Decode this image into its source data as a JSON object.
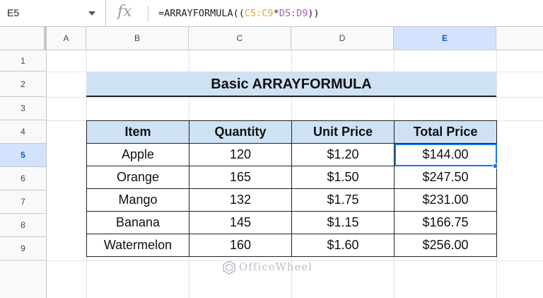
{
  "formula_bar": {
    "cell_ref": "E5",
    "fx_label": "fx",
    "formula_prefix": "=ARRAYFORMULA((",
    "range1": "C5:C9",
    "operator": "*",
    "range2": "D5:D9",
    "formula_suffix": "))"
  },
  "columns": [
    "A",
    "B",
    "C",
    "D",
    "E"
  ],
  "selected_column": "E",
  "rows": [
    "1",
    "2",
    "3",
    "4",
    "5",
    "6",
    "7",
    "8",
    "9"
  ],
  "selected_row": "5",
  "title": "Basic ARRAYFORMULA",
  "table": {
    "headers": [
      "Item",
      "Quantity",
      "Unit Price",
      "Total Price"
    ],
    "rows": [
      [
        "Apple",
        "120",
        "$1.20",
        "$144.00"
      ],
      [
        "Orange",
        "165",
        "$1.50",
        "$247.50"
      ],
      [
        "Mango",
        "132",
        "$1.75",
        "$231.00"
      ],
      [
        "Banana",
        "145",
        "$1.15",
        "$166.75"
      ],
      [
        "Watermelon",
        "160",
        "$1.60",
        "$256.00"
      ]
    ]
  },
  "watermark": "OfficeWheel",
  "colors": {
    "header_fill": "#cfe2f3",
    "selection": "#1a73e8",
    "range1": "#e9a72a",
    "range2": "#b057b3"
  }
}
